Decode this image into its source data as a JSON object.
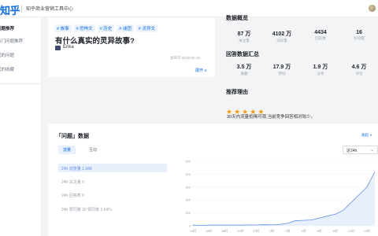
{
  "header": {
    "logo": "知乎",
    "title": "知乎商业营销工具中心"
  },
  "sidebar": {
    "items": [
      {
        "label": "问题推荐",
        "active": true
      },
      {
        "label": "热门问题推荐",
        "active": false
      },
      {
        "label": "我的问题",
        "active": false
      },
      {
        "label": "我的收藏",
        "active": false
      }
    ]
  },
  "question": {
    "tags": [
      "# 故事",
      "# 恐怖文",
      "# 历史",
      "# 谜团",
      "# 灵异文"
    ],
    "title": "有什么真实的灵异故事?",
    "author": "Erika",
    "publish_time": "发布于 2016-02-18",
    "expand_label": "展开 ∨"
  },
  "stats": {
    "overview_title": "数据概览",
    "overview": [
      {
        "value": "87 万",
        "label": "关注量"
      },
      {
        "value": "4102 万",
        "label": "浏览量"
      },
      {
        "value": "4434",
        "label": "回答数"
      },
      {
        "value": "16",
        "label": "好问题"
      }
    ],
    "answers_title": "回答数据汇总",
    "answers": [
      {
        "value": "3.5 万",
        "label": "收藏"
      },
      {
        "value": "17.9 万",
        "label": "赞同"
      },
      {
        "value": "1.9 万",
        "label": "分享"
      },
      {
        "value": "4.6 万",
        "label": "评论"
      }
    ],
    "reason_title": "推荐理由",
    "rating": 5,
    "star_glyph": "★",
    "reason_text": "30天内流量抵稀可观,当前竞争回答相对较少。"
  },
  "data_panel": {
    "title": "「问题」数据",
    "link": "收起 ∧",
    "tabs": [
      "流量",
      "互动"
    ],
    "range_select": "近24h",
    "chevron_icon": "⌄",
    "metrics": [
      {
        "label": "24h 浏览量 1,949",
        "active": true
      },
      {
        "label": "24h 关注量 0",
        "active": false
      },
      {
        "label": "24h 回答数 0",
        "active": false
      },
      {
        "label": "24h 赞同量 30  赞同率 1.54%",
        "active": false
      }
    ]
  },
  "colors": {
    "accent": "#0a6bf1",
    "star": "#f59e0b",
    "line": "#5b8def"
  },
  "chart_data": {
    "type": "area",
    "x": [
      "14时",
      "15时",
      "16时",
      "17时",
      "18时",
      "19时",
      "20时",
      "21时",
      "22时",
      "23时",
      "0时",
      "1时",
      "2时",
      "3时",
      "4时",
      "5时",
      "6时",
      "7时",
      "8时",
      "9时",
      "10时",
      "11时",
      "12时",
      "13时"
    ],
    "series": [
      {
        "values": [
          5,
          4,
          5,
          6,
          5,
          6,
          5,
          7,
          6,
          8,
          7,
          10,
          20,
          40,
          42,
          45,
          60,
          75,
          90,
          120,
          180,
          240,
          300,
          420
        ]
      }
    ],
    "yticks": [
      0,
      100,
      200,
      300,
      400,
      500
    ],
    "ylim": [
      0,
      500
    ],
    "xtick_labels": [
      "14时",
      "16时",
      "18时",
      "20时",
      "22时",
      "0时",
      "2时",
      "4时",
      "6时",
      "8时",
      "10时",
      "12时"
    ],
    "grid": true
  }
}
